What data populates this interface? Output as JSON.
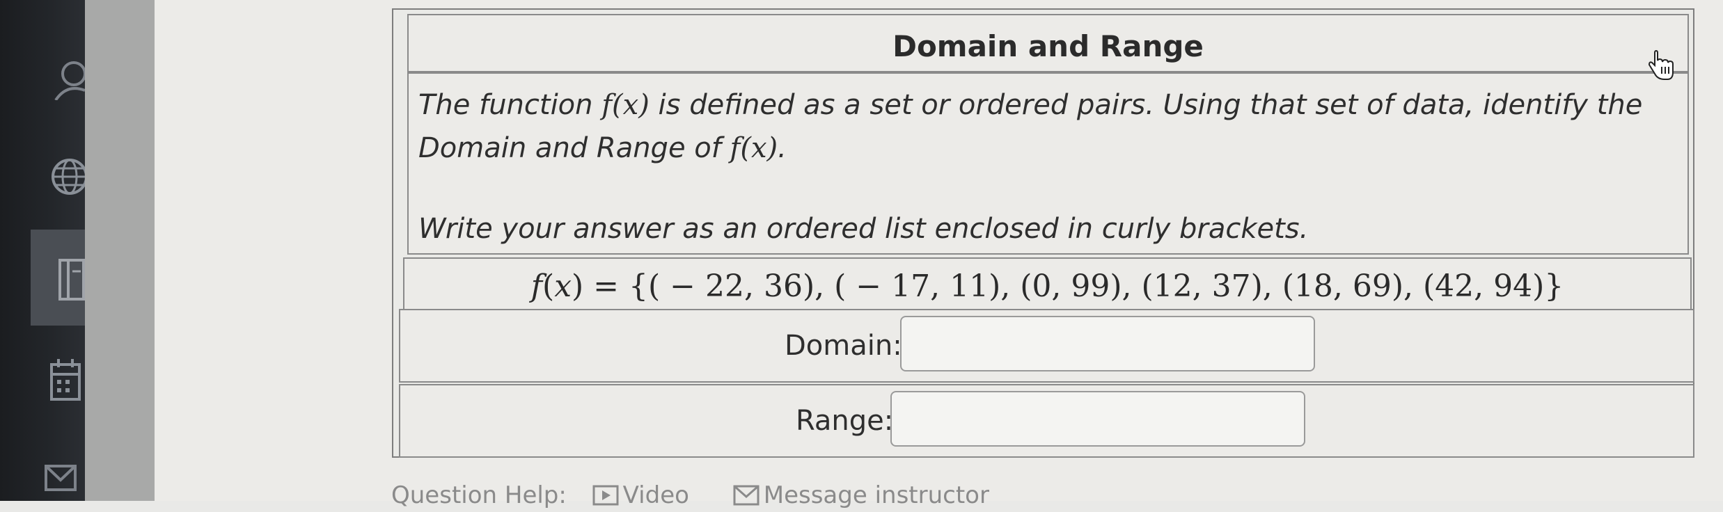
{
  "sidebar": {
    "icons": [
      "user-icon",
      "globe-icon",
      "book-icon",
      "calendar-icon",
      "mail-icon"
    ]
  },
  "question": {
    "title": "Domain and Range",
    "description_line1_a": "The function ",
    "description_line1_b": " is defined as a set or ordered pairs. Using that set of data, identify the",
    "description_line2": "Domain and Range of ",
    "description_line2_end": ".",
    "function_notation": "f(x)",
    "instruction": "Write your answer as an ordered list enclosed in curly brackets.",
    "function_name": "f",
    "function_var": "x",
    "function_set": " = {( − 22, 36),  ( − 17, 11),  (0, 99),  (12, 37),  (18, 69),  (42, 94)}",
    "domain_label": "Domain:",
    "domain_value": "",
    "range_label": "Range:",
    "range_value": ""
  },
  "footer": {
    "question_help_label": "Question Help:",
    "video_label": "Video",
    "message_label": "Message instructor"
  }
}
